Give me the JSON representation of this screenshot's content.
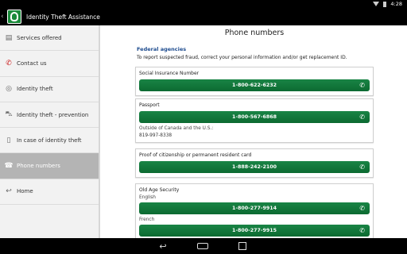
{
  "status": {
    "time": "4:28"
  },
  "app": {
    "title": "Identity Theft Assistance"
  },
  "sidebar": {
    "items": [
      {
        "label": "Services offered"
      },
      {
        "label": "Contact us"
      },
      {
        "label": "Identity theft"
      },
      {
        "label": "Identity theft - prevention"
      },
      {
        "label": "In case of identity theft"
      },
      {
        "label": "Phone numbers"
      },
      {
        "label": "Home"
      }
    ]
  },
  "main": {
    "title": "Phone numbers",
    "section": "Federal agencies",
    "intro": "To report suspected fraud, correct your personal information and/or get replacement ID.",
    "cards": [
      {
        "title": "Social Insurance Number",
        "phone": "1-800-622-6232"
      },
      {
        "title": "Passport",
        "phone": "1-800-567-6868",
        "extra_label": "Outside of Canada and the U.S.:",
        "extra_value": "819-997-8338"
      },
      {
        "title": "Proof of citizenship or permanent resident card",
        "phone": "1-888-242-2100"
      },
      {
        "title": "Old Age Security",
        "lang1": "English",
        "phone1": "1-800-277-9914",
        "lang2": "French",
        "phone2": "1-800-277-9915"
      }
    ]
  }
}
